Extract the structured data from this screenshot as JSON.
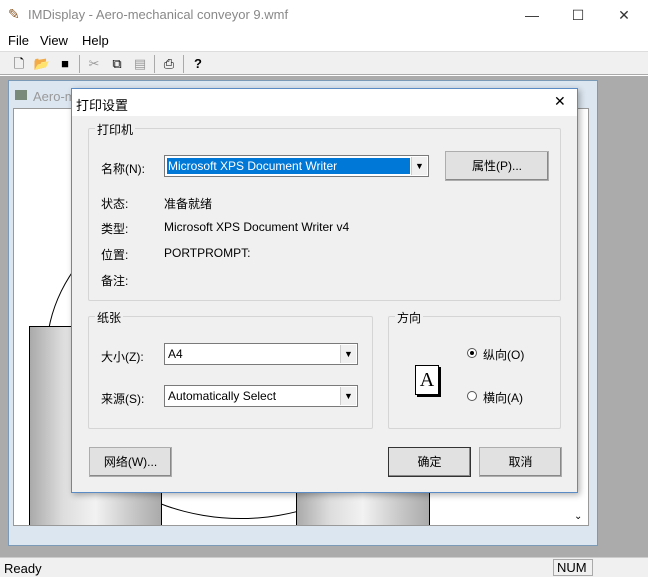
{
  "app": {
    "title": "IMDisplay - Aero-mechanical conveyor 9.wmf",
    "child_title": "Aero-mechanical conveyor 9.wmf"
  },
  "menu": [
    "File",
    "View",
    "Help"
  ],
  "toolbar": [
    "new-icon",
    "open-icon",
    "save-icon",
    "cut-icon",
    "copy-icon",
    "paste-icon",
    "print-icon",
    "help-icon"
  ],
  "status": {
    "text": "Ready",
    "num": "NUM"
  },
  "dialog": {
    "title": "打印设置",
    "printer": {
      "group": "打印机",
      "name_label": "名称(N):",
      "name_value": "Microsoft XPS Document Writer",
      "properties": "属性(P)...",
      "status_label": "状态:",
      "status_value": "准备就绪",
      "type_label": "类型:",
      "type_value": "Microsoft XPS Document Writer v4",
      "where_label": "位置:",
      "where_value": "PORTPROMPT:",
      "comment_label": "备注:"
    },
    "paper": {
      "group": "纸张",
      "size_label": "大小(Z):",
      "size_value": "A4",
      "source_label": "来源(S):",
      "source_value": "Automatically Select"
    },
    "orientation": {
      "group": "方向",
      "portrait": "纵向(O)",
      "landscape": "横向(A)",
      "selected": "portrait",
      "preview_glyph": "A"
    },
    "network": "网络(W)...",
    "ok": "确定",
    "cancel": "取消"
  }
}
